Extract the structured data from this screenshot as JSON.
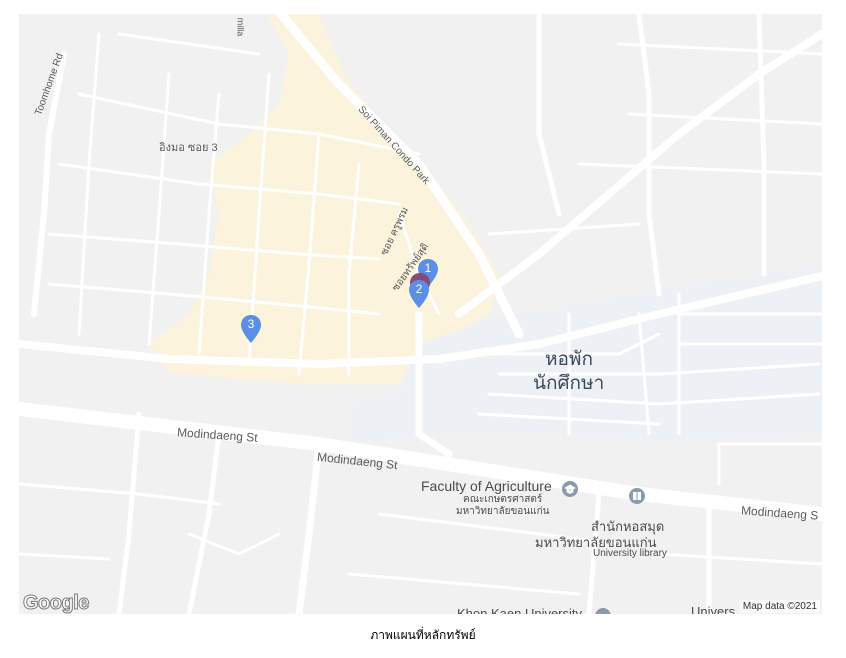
{
  "map": {
    "street_labels": {
      "modindaeng_1": "Modindaeng St",
      "modindaeng_2": "Modindaeng St",
      "modindaeng_3": "Modindaeng S",
      "toomhome": "Toomhome Rd",
      "soi_piman": "Soi Piman Condo Park",
      "soi_ingmor": "อิงมอ ซอย 3",
      "soi_kru": "ซอย ครูพรม",
      "soi_thai": "ซอยทรัพย์สุดิ",
      "amila": "milla"
    },
    "area_label_line1": "หอพัก",
    "area_label_line2": "นักศึกษา",
    "poi_faculty": "Faculty of Agriculture",
    "poi_faculty_thai": "คณะเกษตรศาสตร์",
    "poi_faculty_thai2": "มหาวิทยาลัยขอนแก่น",
    "poi_library_thai1": "สำนักหอสมุด",
    "poi_library_thai2": "มหาวิทยาลัยขอนแก่น",
    "poi_library_en": "University library",
    "poi_kku": "Khon Kaen University",
    "poi_univers": "Univers",
    "markers": [
      {
        "label": "1",
        "color": "#5b8fe6"
      },
      {
        "label": "2",
        "color": "#5b8fe6"
      },
      {
        "label": "3",
        "color": "#5b8fe6"
      }
    ],
    "google_logo": "Google",
    "attribution": "Map data ©2021",
    "colors": {
      "land": "#f1f1f1",
      "road": "#ffffff",
      "residential": "#fcf3dc",
      "campus": "#edf0f5",
      "marker": "#5b8fe6",
      "poi_icon": "#8a9aad"
    }
  },
  "caption": "ภาพแผนที่หลักทรัพย์"
}
